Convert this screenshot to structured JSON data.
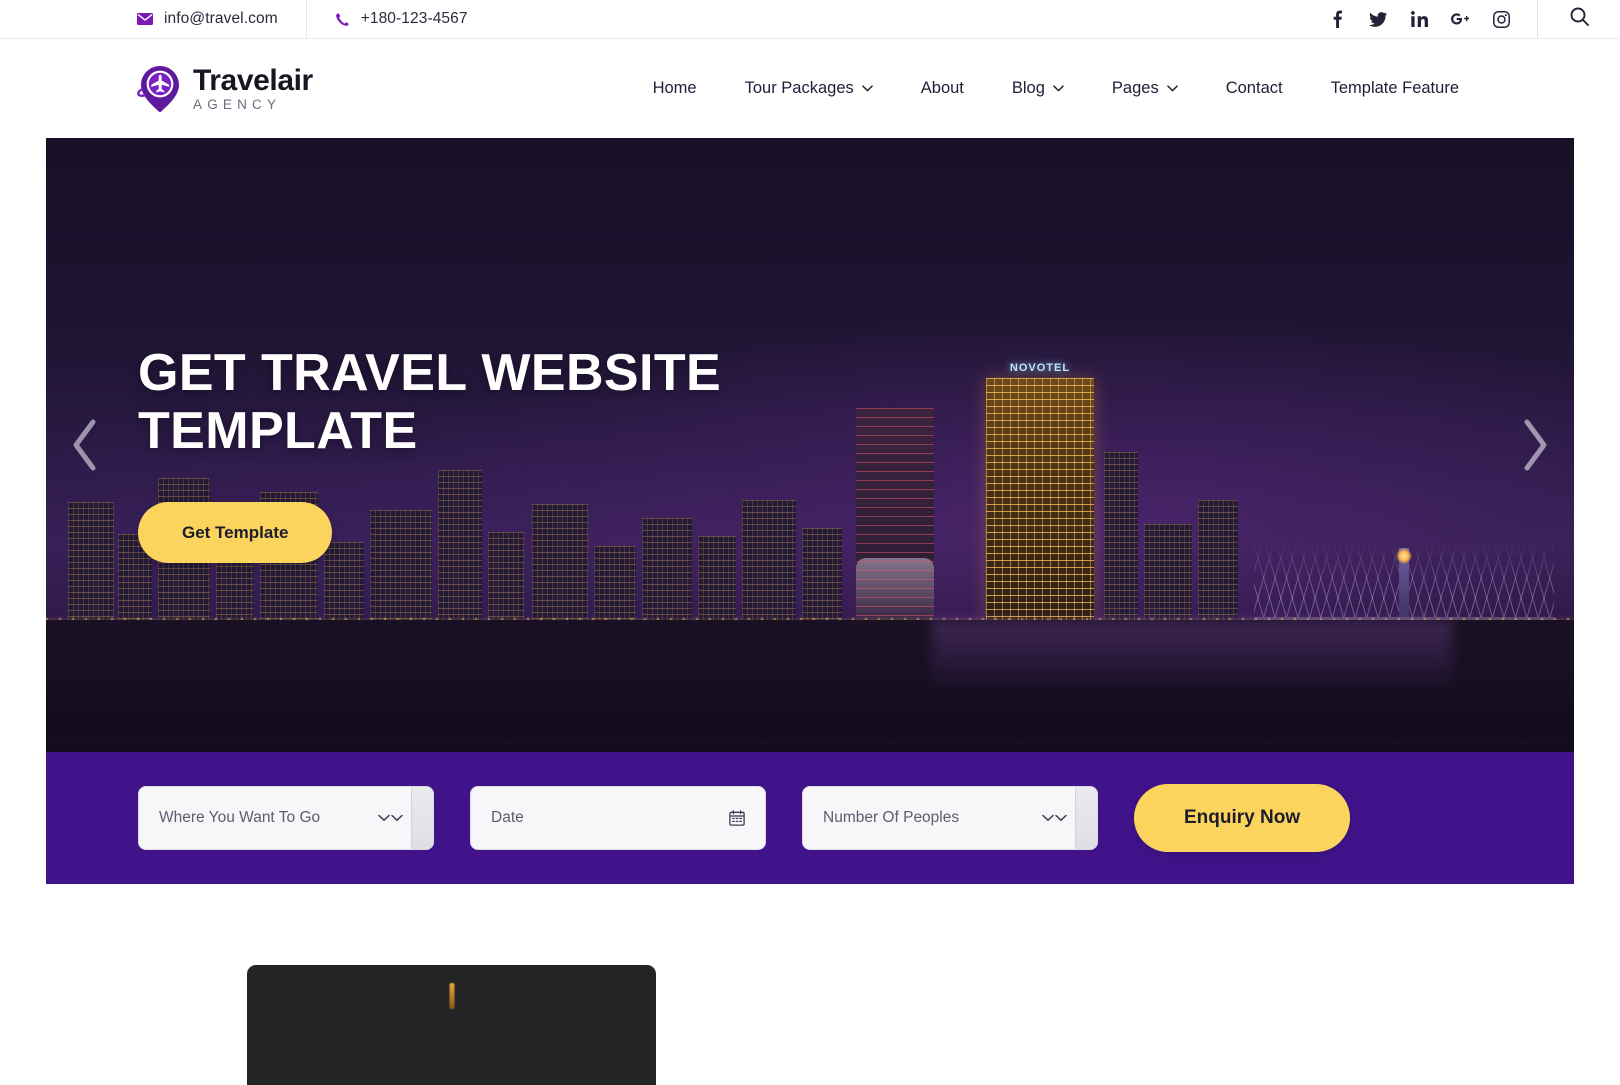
{
  "topbar": {
    "email": "info@travel.com",
    "phone": "+180-123-4567",
    "email_icon": "envelope-icon",
    "phone_icon": "phone-icon",
    "socials": [
      {
        "name": "facebook-icon",
        "label": "f"
      },
      {
        "name": "twitter-icon",
        "label": "t"
      },
      {
        "name": "linkedin-icon",
        "label": "in"
      },
      {
        "name": "google-plus-icon",
        "label": "G+"
      },
      {
        "name": "instagram-icon",
        "label": "ig"
      }
    ],
    "search_icon": "search-icon"
  },
  "header": {
    "logo_name": "Travelair",
    "logo_sub": "AGENCY",
    "logo_icon": "map-pin-airplane-icon",
    "nav": [
      {
        "label": "Home",
        "dropdown": false
      },
      {
        "label": "Tour Packages",
        "dropdown": true
      },
      {
        "label": "About",
        "dropdown": false
      },
      {
        "label": "Blog",
        "dropdown": true
      },
      {
        "label": "Pages",
        "dropdown": true
      },
      {
        "label": "Contact",
        "dropdown": false
      },
      {
        "label": "Template Feature",
        "dropdown": false
      }
    ]
  },
  "hero": {
    "title": "Get Travel Website Template",
    "cta_label": "Get Template",
    "prev_icon": "chevron-left-icon",
    "next_icon": "chevron-right-icon",
    "scene_label": "NOVOTEL"
  },
  "searchbar": {
    "destination": "Where You Want To Go",
    "date": "Date",
    "people": "Number Of Peoples",
    "submit_label": "Enquiry Now",
    "calendar_icon": "calendar-icon",
    "background_color": "#40138a"
  },
  "colors": {
    "accent_yellow": "#fbd45e",
    "brand_purple": "#40138a",
    "icon_purple": "#7b18b8",
    "text_dark": "#20203a"
  }
}
